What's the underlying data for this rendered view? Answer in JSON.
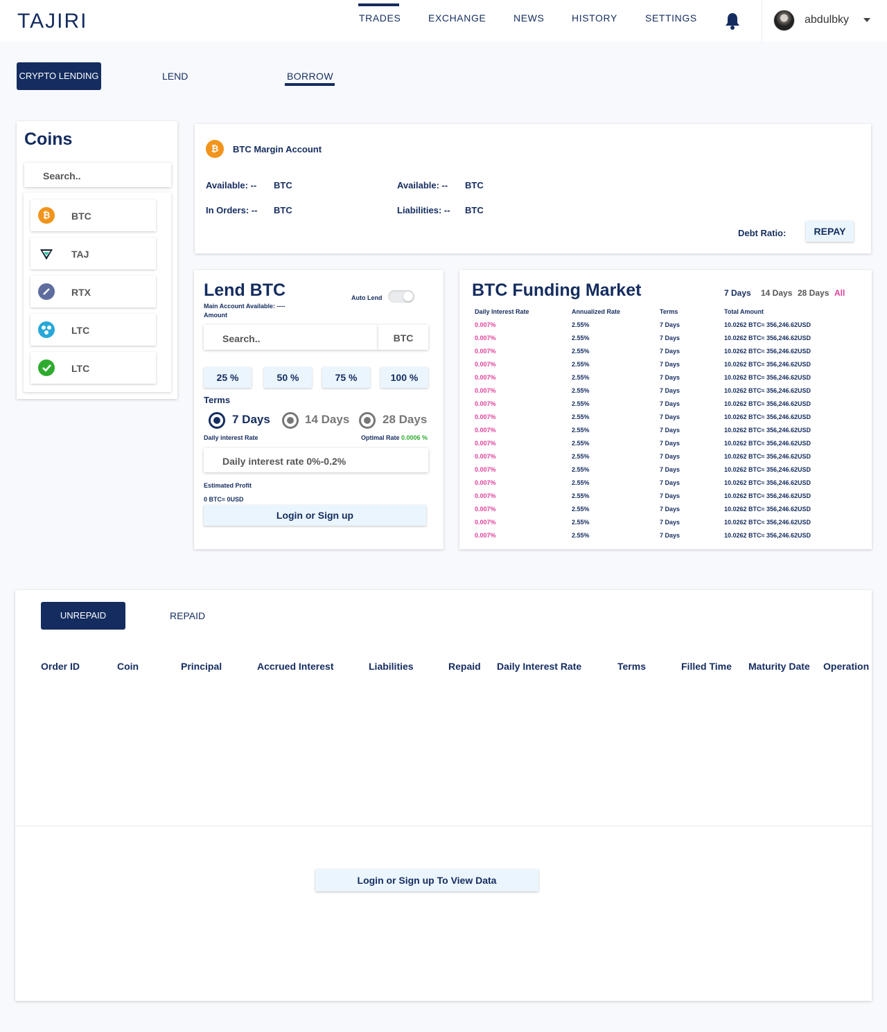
{
  "header": {
    "logo": "TAJIRI",
    "nav": [
      "TRADES",
      "EXCHANGE",
      "NEWS",
      "HISTORY",
      "SETTINGS"
    ],
    "active_nav": "TRADES",
    "username": "abdulbky"
  },
  "tabs": {
    "crypto_lending": "CRYPTO LENDING",
    "lend": "LEND",
    "borrow": "BORROW",
    "active": "BORROW"
  },
  "coins": {
    "title": "Coins",
    "search_placeholder": "Search..",
    "list": [
      {
        "symbol": "BTC",
        "icon": "bitcoin-icon",
        "color": "#f2941c"
      },
      {
        "symbol": "TAJ",
        "icon": "taj-icon",
        "color": "#0e1c2e"
      },
      {
        "symbol": "RTX",
        "icon": "rtx-icon",
        "color": "#5e6d9e"
      },
      {
        "symbol": "LTC",
        "icon": "ltc-blue-icon",
        "color": "#27a8d8"
      },
      {
        "symbol": "LTC",
        "icon": "ltc-green-icon",
        "color": "#2eab2e"
      }
    ]
  },
  "margin": {
    "title": "BTC Margin Account",
    "available_label": "Available: --",
    "in_orders_label": "In Orders: --",
    "liabilities_label": "Liabilities: --",
    "currency": "BTC",
    "debt_ratio_label": "Debt Ratio:",
    "repay_label": "REPAY"
  },
  "lend": {
    "title": "Lend BTC",
    "auto_lend": "Auto Lend",
    "main_account": "Main Account Available:  ----",
    "amount_label": "Amount",
    "search_placeholder": "Search..",
    "currency": "BTC",
    "percents": [
      "25 %",
      "50 %",
      "75 %",
      "100 %"
    ],
    "terms_label": "Terms",
    "terms": [
      "7 Days",
      "14 Days",
      "28 Days"
    ],
    "selected_term": "7 Days",
    "daily_rate_label": "Daily interest Rate",
    "optimal_rate_label": "Optimal Rate",
    "optimal_rate_value": "0.0006 %",
    "daily_rate_placeholder": "Daily interest rate 0%-0.2%",
    "estimated_profit_label": "Estimated Profit",
    "estimated_profit_value": "0 BTC≈ 0USD",
    "login_label": "Login or Sign up"
  },
  "funding": {
    "title": "BTC Funding Market",
    "filters": [
      "7 Days",
      "14 Days",
      "28 Days",
      "All"
    ],
    "active_filter": "All",
    "columns": [
      "Daily Interest Rate",
      "Annualized Rate",
      "Terms",
      "Total Amount"
    ],
    "rows": [
      [
        "0.007%",
        "2.55%",
        "7 Days",
        "10.0262 BTC≈ 356,246.62USD"
      ],
      [
        "0.007%",
        "2.55%",
        "7 Days",
        "10.0262 BTC≈ 356,246.62USD"
      ],
      [
        "0.007%",
        "2.55%",
        "7 Days",
        "10.0262 BTC≈ 356,246.62USD"
      ],
      [
        "0.007%",
        "2.55%",
        "7 Days",
        "10.0262 BTC≈ 356,246.62USD"
      ],
      [
        "0.007%",
        "2.55%",
        "7 Days",
        "10.0262 BTC≈ 356,246.62USD"
      ],
      [
        "0.007%",
        "2.55%",
        "7 Days",
        "10.0262 BTC≈ 356,246.62USD"
      ],
      [
        "0.007%",
        "2.55%",
        "7 Days",
        "10.0262 BTC≈ 356,246.62USD"
      ],
      [
        "0.007%",
        "2.55%",
        "7 Days",
        "10.0262 BTC≈ 356,246.62USD"
      ],
      [
        "0.007%",
        "2.55%",
        "7 Days",
        "10.0262 BTC≈ 356,246.62USD"
      ],
      [
        "0.007%",
        "2.55%",
        "7 Days",
        "10.0262 BTC≈ 356,246.62USD"
      ],
      [
        "0.007%",
        "2.55%",
        "7 Days",
        "10.0262 BTC≈ 356,246.62USD"
      ],
      [
        "0.007%",
        "2.55%",
        "7 Days",
        "10.0262 BTC≈ 356,246.62USD"
      ],
      [
        "0.007%",
        "2.55%",
        "7 Days",
        "10.0262 BTC≈ 356,246.62USD"
      ],
      [
        "0.007%",
        "2.55%",
        "7 Days",
        "10.0262 BTC≈ 356,246.62USD"
      ],
      [
        "0.007%",
        "2.55%",
        "7 Days",
        "10.0262 BTC≈ 356,246.62USD"
      ],
      [
        "0.007%",
        "2.55%",
        "7 Days",
        "10.0262 BTC≈ 356,246.62USD"
      ],
      [
        "0.007%",
        "2.55%",
        "7 Days",
        "10.0262 BTC≈ 356,246.62USD"
      ]
    ]
  },
  "orders": {
    "tabs": [
      "UNREPAID",
      "REPAID"
    ],
    "active_tab": "UNREPAID",
    "columns": [
      "Order ID",
      "Coin",
      "Principal",
      "Accrued Interest",
      "Liabilities",
      "Repaid",
      "Daily Interest Rate",
      "Terms",
      "Filled Time",
      "Maturity Date",
      "Operation"
    ],
    "view_label": "Login or Sign up To View Data"
  },
  "colors": {
    "primary": "#142c5f",
    "accent_pink": "#e0409b",
    "accent_green": "#2eab2e",
    "button_bg": "#ebf5fd"
  }
}
